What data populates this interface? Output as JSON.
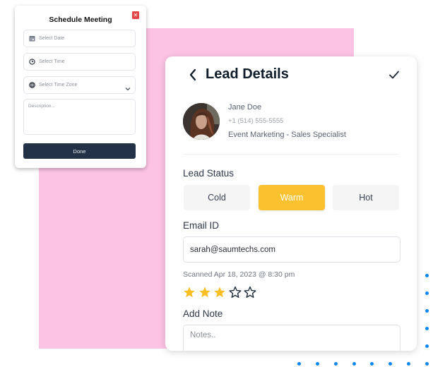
{
  "schedule_modal": {
    "title": "Schedule Meeting",
    "close_icon": "close-icon",
    "date_field": {
      "icon": "calendar-icon",
      "placeholder": "Select Date"
    },
    "time_field": {
      "icon": "clock-icon",
      "placeholder": "Select Time"
    },
    "timezone_field": {
      "icon": "globe-icon",
      "placeholder": "Select Time Zone",
      "dropdown_icon": "chevron-down-icon"
    },
    "description": {
      "placeholder": "Description..."
    },
    "done_label": "Done"
  },
  "lead_card": {
    "back_icon": "chevron-left-icon",
    "title": "Lead Details",
    "confirm_icon": "check-icon",
    "lead": {
      "name": "Jane Doe",
      "phone": "+1 (514) 555-5555",
      "role": "Event Marketing - Sales Specialist"
    },
    "lead_status": {
      "label": "Lead Status",
      "options": [
        "Cold",
        "Warm",
        "Hot"
      ],
      "selected": "Warm"
    },
    "email": {
      "label": "Email ID",
      "value": "sarah@saumtechs.com"
    },
    "scanned": "Scanned Apr 18, 2023 @ 8:30 pm",
    "rating": {
      "value": 3,
      "max": 5
    },
    "note": {
      "label": "Add Note",
      "placeholder": "Notes.."
    }
  },
  "colors": {
    "accent_warm": "#fcc12e",
    "done_button": "#243248",
    "close_button": "#e24646",
    "background_block": "#fcc3e4",
    "dots": "#0b87f5",
    "star_filled": "#fbbf24",
    "star_empty_stroke": "#1f2d3d"
  }
}
